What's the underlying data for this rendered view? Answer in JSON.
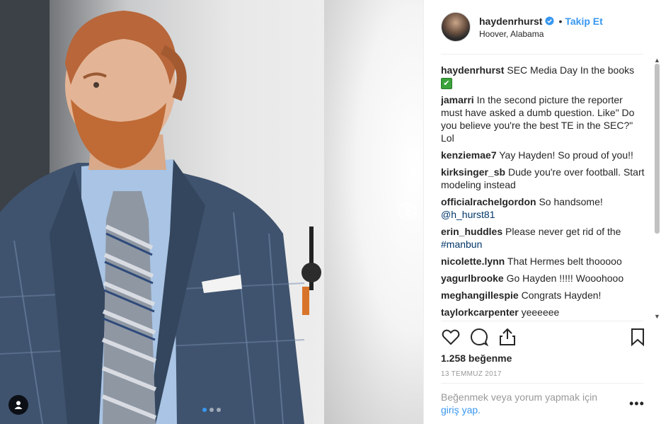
{
  "post": {
    "username": "haydenrhurst",
    "follow_label": "Takip Et",
    "bullet": "•",
    "location": "Hoover, Alabama",
    "likes": "1.258 beğenme",
    "date": "13 TEMMUZ 2017",
    "login_prompt": "Beğenmek veya yorum yapmak için",
    "login_link_a": "giriş",
    "login_link_b": "yap.",
    "more_label": "•••"
  },
  "carousel": {
    "current": 1,
    "total": 3
  },
  "colors": {
    "accent": "#3897f0",
    "text": "#262626",
    "muted": "#999999",
    "link": "#003569"
  },
  "caption": {
    "user": "haydenrhurst",
    "text": "SEC Media Day In the books",
    "emoji": "✔"
  },
  "comments": [
    {
      "user": "jamarri",
      "text": "In the second picture the reporter must have asked a dumb question. Like\" Do you believe you're the best TE in the SEC?\" Lol"
    },
    {
      "user": "kenziemae7",
      "text": "Yay Hayden! So proud of you!!"
    },
    {
      "user": "kirksinger_sb",
      "text": "Dude you're over football. Start modeling instead"
    },
    {
      "user": "officialrachelgordon",
      "text": "So handsome!",
      "link": "@h_hurst81"
    },
    {
      "user": "erin_huddles",
      "text": "Please never get rid of the",
      "link": "#manbun"
    },
    {
      "user": "nicolette.lynn",
      "text": "That Hermes belt thooooo"
    },
    {
      "user": "yagurlbrooke",
      "text": "Go Hayden !!!!! Wooohooo"
    },
    {
      "user": "meghangillespie",
      "text": "Congrats Hayden!"
    },
    {
      "user": "taylorkcarpenter",
      "text": "yeeeeee"
    }
  ],
  "icons": [
    "heart-icon",
    "comment-icon",
    "share-icon",
    "bookmark-icon",
    "chevron-right-icon",
    "user-tag-icon",
    "verified-badge-icon"
  ]
}
